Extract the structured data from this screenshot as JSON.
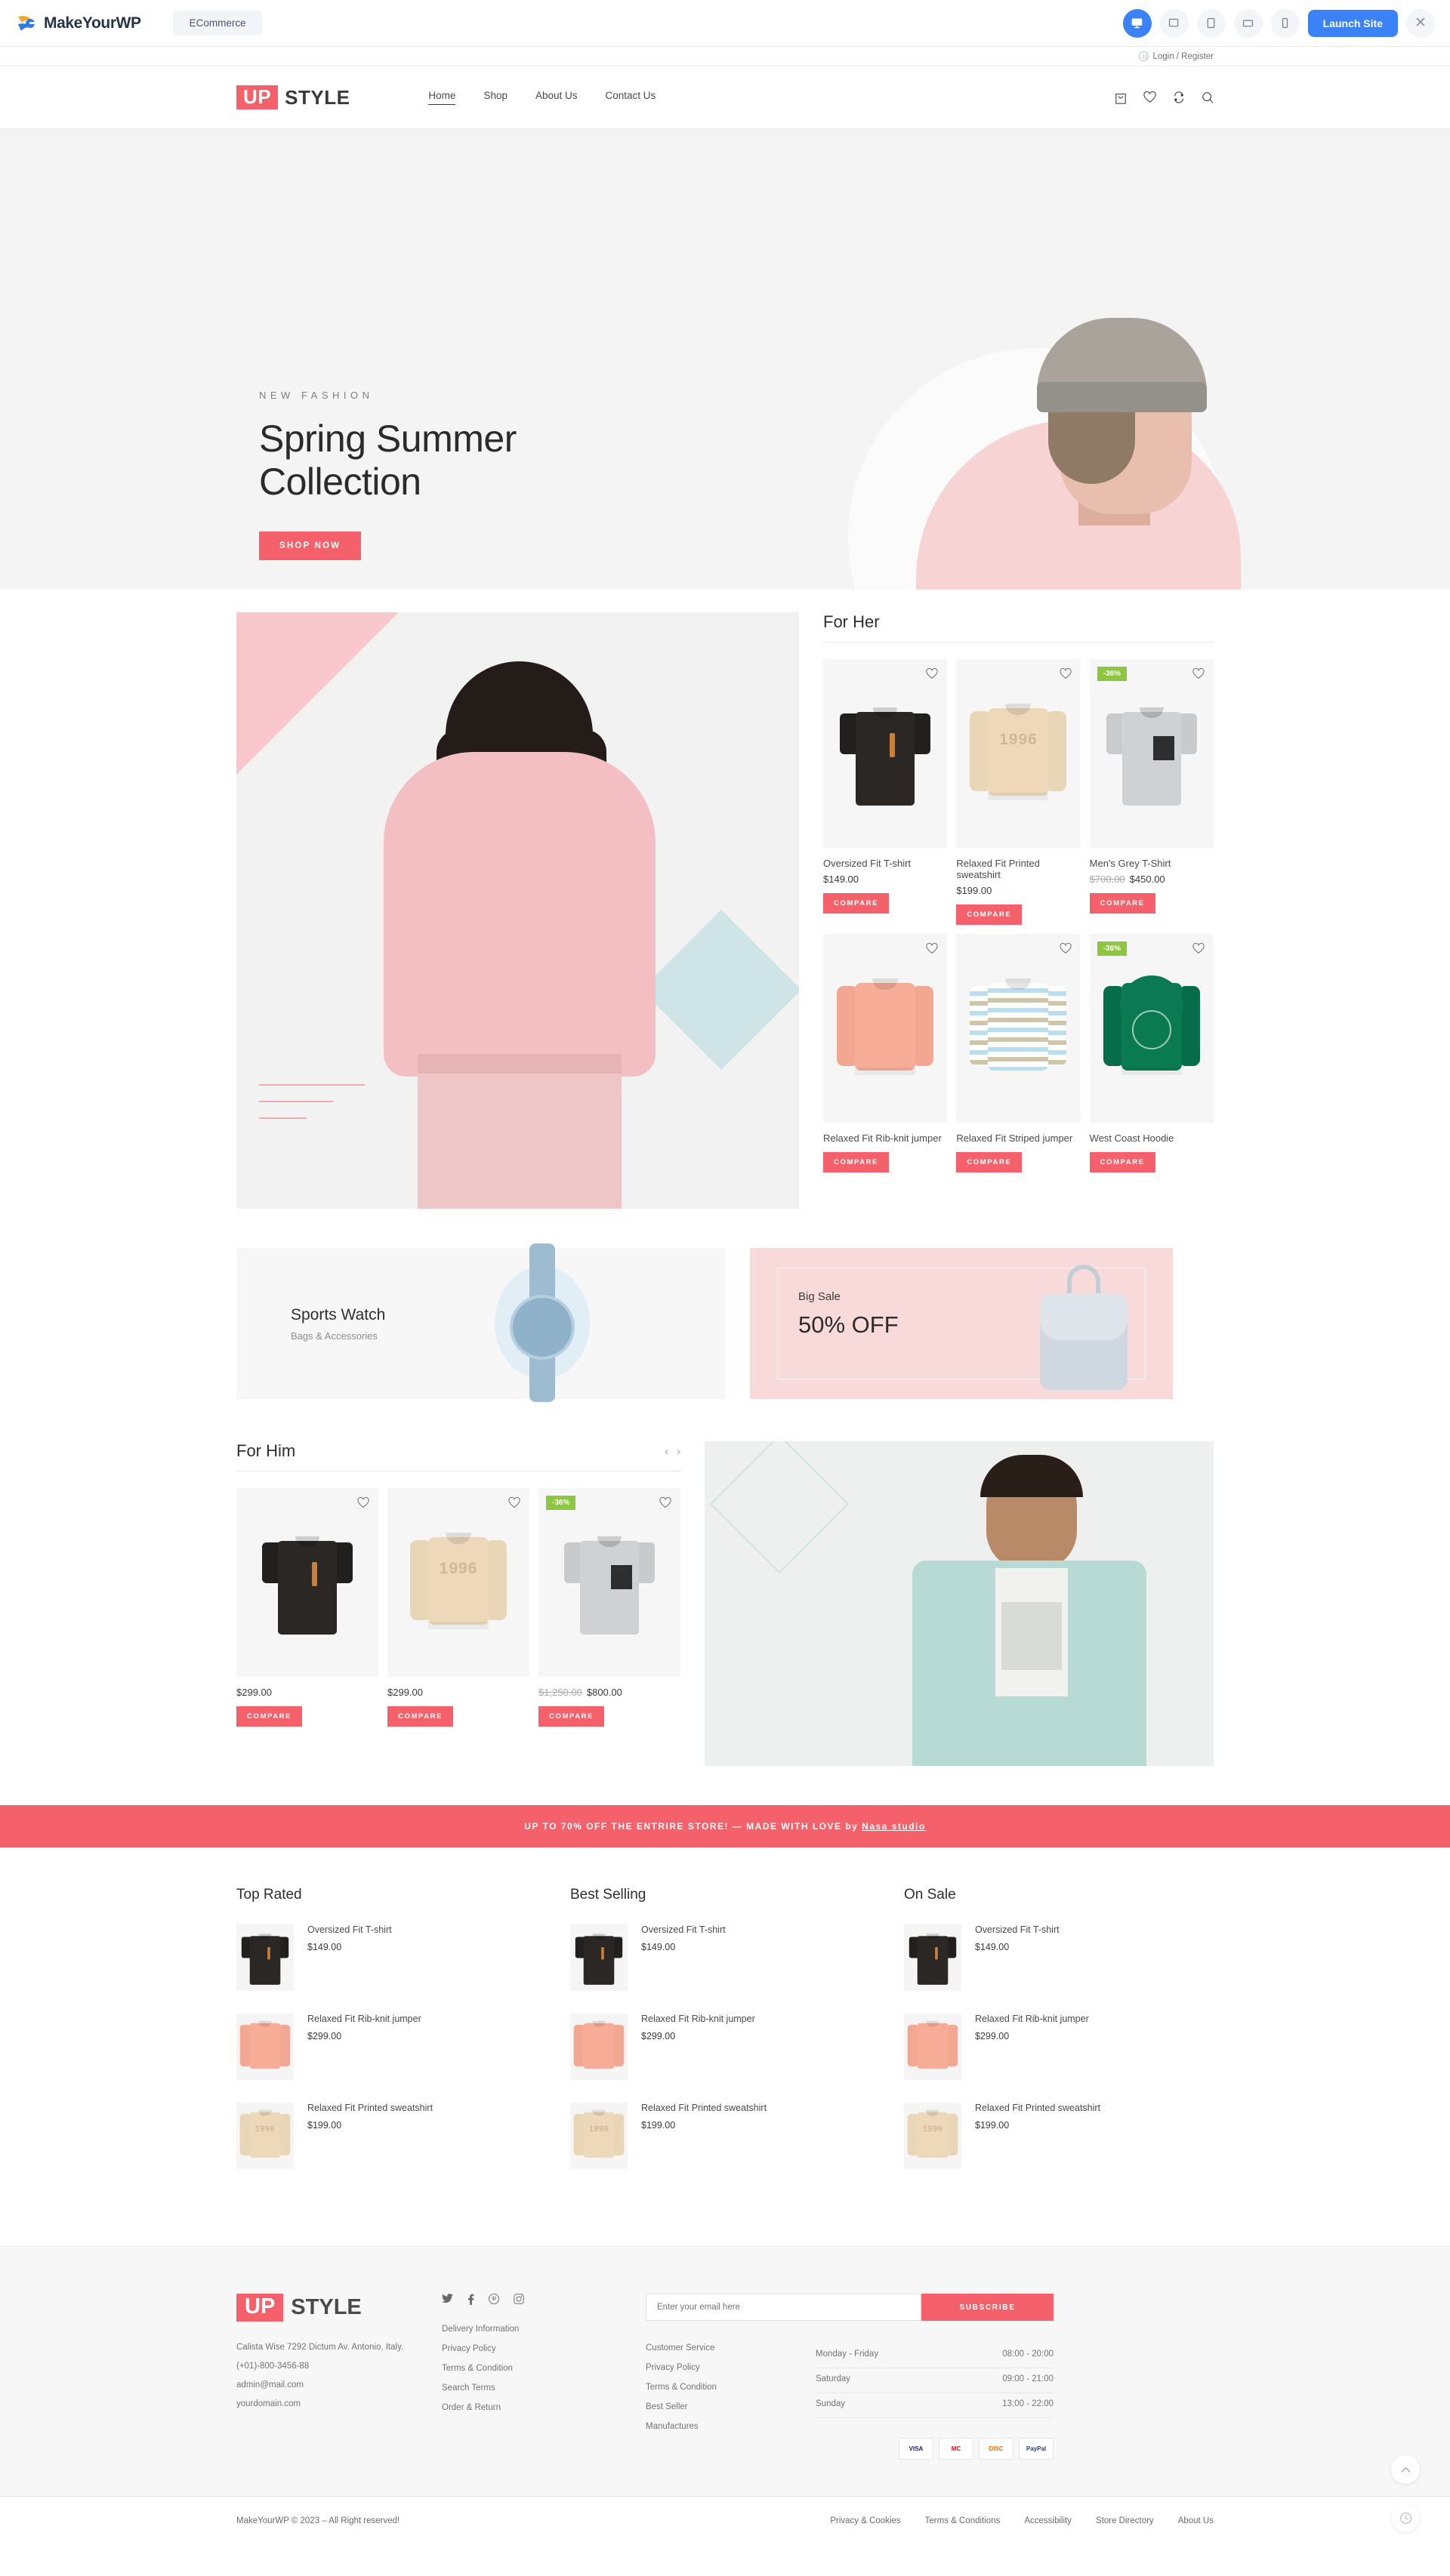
{
  "builder": {
    "product_name": "MakeYourWP",
    "template_chip": "ECommerce",
    "devices": [
      {
        "name": "desktop-view-button",
        "icon": "monitor-icon",
        "active": true
      },
      {
        "name": "laptop-view-button",
        "icon": "laptop-icon",
        "active": false
      },
      {
        "name": "tablet-portrait-view-button",
        "icon": "tablet-icon",
        "active": false
      },
      {
        "name": "tablet-landscape-view-button",
        "icon": "tablet-landscape-icon",
        "active": false
      },
      {
        "name": "mobile-view-button",
        "icon": "mobile-icon",
        "active": false
      }
    ],
    "launch_label": "Launch Site",
    "close_label": "✕",
    "accent": "#3b82f6"
  },
  "topbar": {
    "login_label": "Login / Register"
  },
  "header": {
    "brand_up": "UP",
    "brand_style": "STYLE",
    "nav": [
      {
        "label": "Home",
        "active": true
      },
      {
        "label": "Shop",
        "active": false
      },
      {
        "label": "About Us",
        "active": false
      },
      {
        "label": "Contact Us",
        "active": false
      }
    ],
    "icons": [
      "cart-icon",
      "heart-icon",
      "compare-icon",
      "search-icon"
    ]
  },
  "hero": {
    "eyebrow": "NEW FASHION",
    "title_line1": "Spring Summer",
    "title_line2": "Collection",
    "cta": "SHOP NOW",
    "accent": "#f4616a"
  },
  "for_her": {
    "title": "For Her",
    "products": [
      {
        "name": "Oversized Fit T-shirt",
        "price": "$149.00",
        "old_price": "",
        "badge": "",
        "compare": "COMPARE",
        "kind": "tee-black"
      },
      {
        "name": "Relaxed Fit Printed sweatshirt",
        "price": "$199.00",
        "old_price": "",
        "badge": "",
        "compare": "COMPARE",
        "kind": "sweat-beige"
      },
      {
        "name": "Men's Grey T-Shirt",
        "price": "$450.00",
        "old_price": "$700.00",
        "badge": "-36%",
        "compare": "COMPARE",
        "kind": "tee-grey"
      },
      {
        "name": "Relaxed Fit Rib-knit jumper",
        "price": "",
        "old_price": "",
        "badge": "",
        "compare": "COMPARE",
        "kind": "sweat-pink"
      },
      {
        "name": "Relaxed Fit Striped jumper",
        "price": "",
        "old_price": "",
        "badge": "",
        "compare": "COMPARE",
        "kind": "sweat-stripe"
      },
      {
        "name": "West Coast Hoodie",
        "price": "",
        "old_price": "",
        "badge": "-36%",
        "compare": "COMPARE",
        "kind": "hoodie-green"
      }
    ]
  },
  "promo_watch": {
    "title": "Sports Watch",
    "subtitle": "Bags & Accessories"
  },
  "promo_sale": {
    "eyebrow": "Big Sale",
    "headline": "50% OFF"
  },
  "for_him": {
    "title": "For Him",
    "prev": "‹",
    "next": "›",
    "products": [
      {
        "name": "",
        "price": "$299.00",
        "old_price": "",
        "badge": "",
        "compare": "COMPARE",
        "kind": "tee-black"
      },
      {
        "name": "",
        "price": "$299.00",
        "old_price": "",
        "badge": "",
        "compare": "COMPARE",
        "kind": "sweat-beige"
      },
      {
        "name": "",
        "price": "$800.00",
        "old_price": "$1,250.00",
        "badge": "-36%",
        "compare": "COMPARE",
        "kind": "tee-grey"
      }
    ]
  },
  "red_strip": {
    "text": "UP TO 70% OFF THE ENTRIRE STORE! — MADE WITH LOVE by ",
    "link": "Nasa studio",
    "color": "#f4616a"
  },
  "lists": [
    {
      "title": "Top Rated",
      "items": [
        {
          "name": "Oversized Fit T-shirt",
          "price": "$149.00",
          "kind": "tee-black"
        },
        {
          "name": "Relaxed Fit Rib-knit jumper",
          "price": "$299.00",
          "kind": "sweat-pink"
        },
        {
          "name": "Relaxed Fit Printed sweatshirt",
          "price": "$199.00",
          "kind": "sweat-beige"
        }
      ]
    },
    {
      "title": "Best Selling",
      "items": [
        {
          "name": "Oversized Fit T-shirt",
          "price": "$149.00",
          "kind": "tee-black"
        },
        {
          "name": "Relaxed Fit Rib-knit jumper",
          "price": "$299.00",
          "kind": "sweat-pink"
        },
        {
          "name": "Relaxed Fit Printed sweatshirt",
          "price": "$199.00",
          "kind": "sweat-beige"
        }
      ]
    },
    {
      "title": "On Sale",
      "items": [
        {
          "name": "Oversized Fit T-shirt",
          "price": "$149.00",
          "kind": "tee-black"
        },
        {
          "name": "Relaxed Fit Rib-knit jumper",
          "price": "$299.00",
          "kind": "sweat-pink"
        },
        {
          "name": "Relaxed Fit Printed sweatshirt",
          "price": "$199.00",
          "kind": "sweat-beige"
        }
      ]
    }
  ],
  "footer": {
    "brand_up": "UP",
    "brand_style": "STYLE",
    "address": [
      "Calista Wise 7292 Dictum Av. Antonio, Italy.",
      "(+01)-800-3456-88",
      "admin@mail.com",
      "yourdomain.com"
    ],
    "social": [
      "twitter-icon",
      "facebook-icon",
      "pinterest-icon",
      "instagram-icon"
    ],
    "links": [
      "Delivery Information",
      "Privacy Policy",
      "Terms & Condition",
      "Search Terms",
      "Order & Return"
    ],
    "newsletter": {
      "placeholder": "Enter your email here",
      "value": "",
      "button": "SUBSCRIBE"
    },
    "service_links": [
      "Customer Service",
      "Privacy Policy",
      "Terms & Condition",
      "Best Seller",
      "Manufactures"
    ],
    "hours": [
      {
        "day": "Monday - Friday",
        "time": "08:00 - 20:00"
      },
      {
        "day": "Saturday",
        "time": "09:00 - 21:00"
      },
      {
        "day": "Sunday",
        "time": "13:00 - 22:00"
      }
    ],
    "payments": [
      {
        "label": "VISA",
        "name": "visa-icon"
      },
      {
        "label": "MC",
        "name": "mastercard-icon"
      },
      {
        "label": "DISC",
        "name": "discover-icon"
      },
      {
        "label": "PayPal",
        "name": "paypal-icon"
      }
    ],
    "copyright": "MakeYourWP © 2023 – All Right reserved!",
    "bottom_links": [
      "Privacy & Cookies",
      "Terms & Conditions",
      "Accessibility",
      "Store Directory",
      "About Us"
    ]
  },
  "fabs": {
    "top": "scroll-to-top-icon",
    "help": "help-clock-icon"
  }
}
